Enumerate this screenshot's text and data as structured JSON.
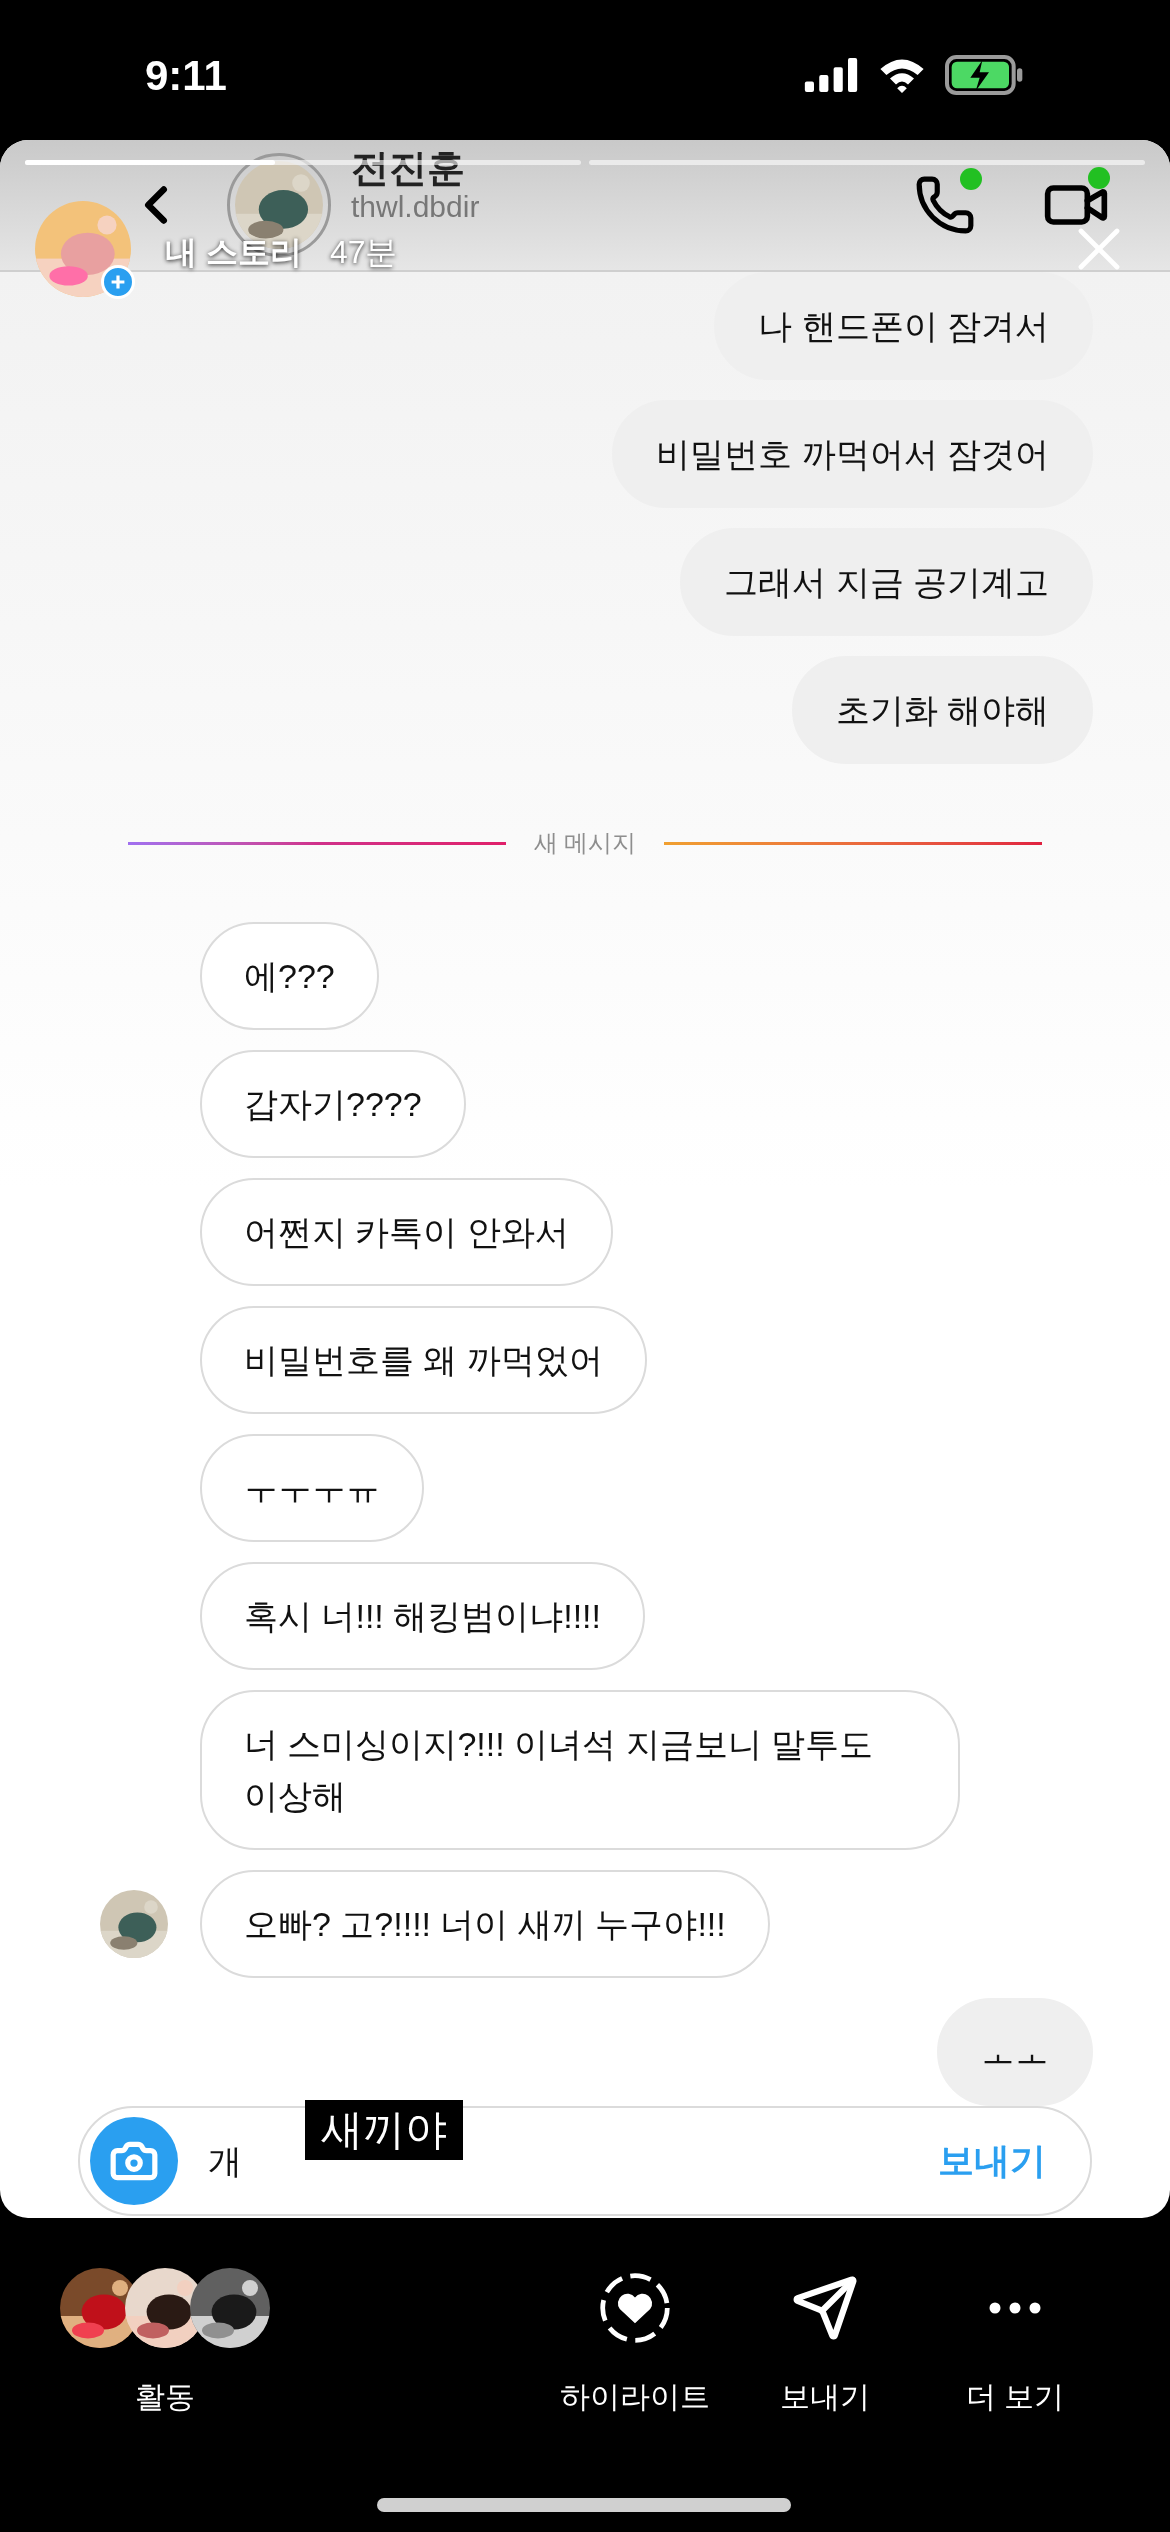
{
  "status_bar": {
    "time": "9:11"
  },
  "story": {
    "progress": [
      {
        "current": true,
        "level": 0.45
      },
      {
        "current": false
      }
    ],
    "owner": "내 스토리",
    "age": "47분"
  },
  "chat_header": {
    "name": "전진훈",
    "username": "thwl.dbdir",
    "call_online": true,
    "video_online": true
  },
  "messages": [
    {
      "kind": "message",
      "from_me": true,
      "text": "나 핸드폰이 잠겨서"
    },
    {
      "kind": "message",
      "from_me": true,
      "text": "비밀번호 까먹어서 잠겻어"
    },
    {
      "kind": "message",
      "from_me": true,
      "text": "그래서 지금 공기계고"
    },
    {
      "kind": "message",
      "from_me": true,
      "text": "초기화 해야해"
    },
    {
      "kind": "divider",
      "text": "새 메시지"
    },
    {
      "kind": "message",
      "from_me": false,
      "text": "에???"
    },
    {
      "kind": "message",
      "from_me": false,
      "text": "갑자기????"
    },
    {
      "kind": "message",
      "from_me": false,
      "text": "어쩐지 카톡이 안와서"
    },
    {
      "kind": "message",
      "from_me": false,
      "text": "비밀번호를 왜 까먹었어"
    },
    {
      "kind": "message",
      "from_me": false,
      "text": "ㅜㅜㅜㅠ"
    },
    {
      "kind": "message",
      "from_me": false,
      "text": "혹시 너!!! 해킹범이냐!!!!"
    },
    {
      "kind": "message",
      "from_me": false,
      "text": "너 스미싱이지?!!! 이녀석 지금보니 말투도 이상해"
    },
    {
      "kind": "message",
      "from_me": false,
      "text": "오빠? 고?!!!! 너이 새끼 누구야!!!",
      "avatar": true
    },
    {
      "kind": "message",
      "from_me": true,
      "text": "ㅗㅗ"
    }
  ],
  "composer": {
    "value": "개",
    "send": "보내기"
  },
  "sticker": "새끼야",
  "footer": {
    "activity": "활동",
    "actions": [
      {
        "kind": "highlight",
        "label": "하이라이트"
      },
      {
        "kind": "send",
        "label": "보내기"
      },
      {
        "kind": "more",
        "label": "더 보기"
      }
    ]
  }
}
